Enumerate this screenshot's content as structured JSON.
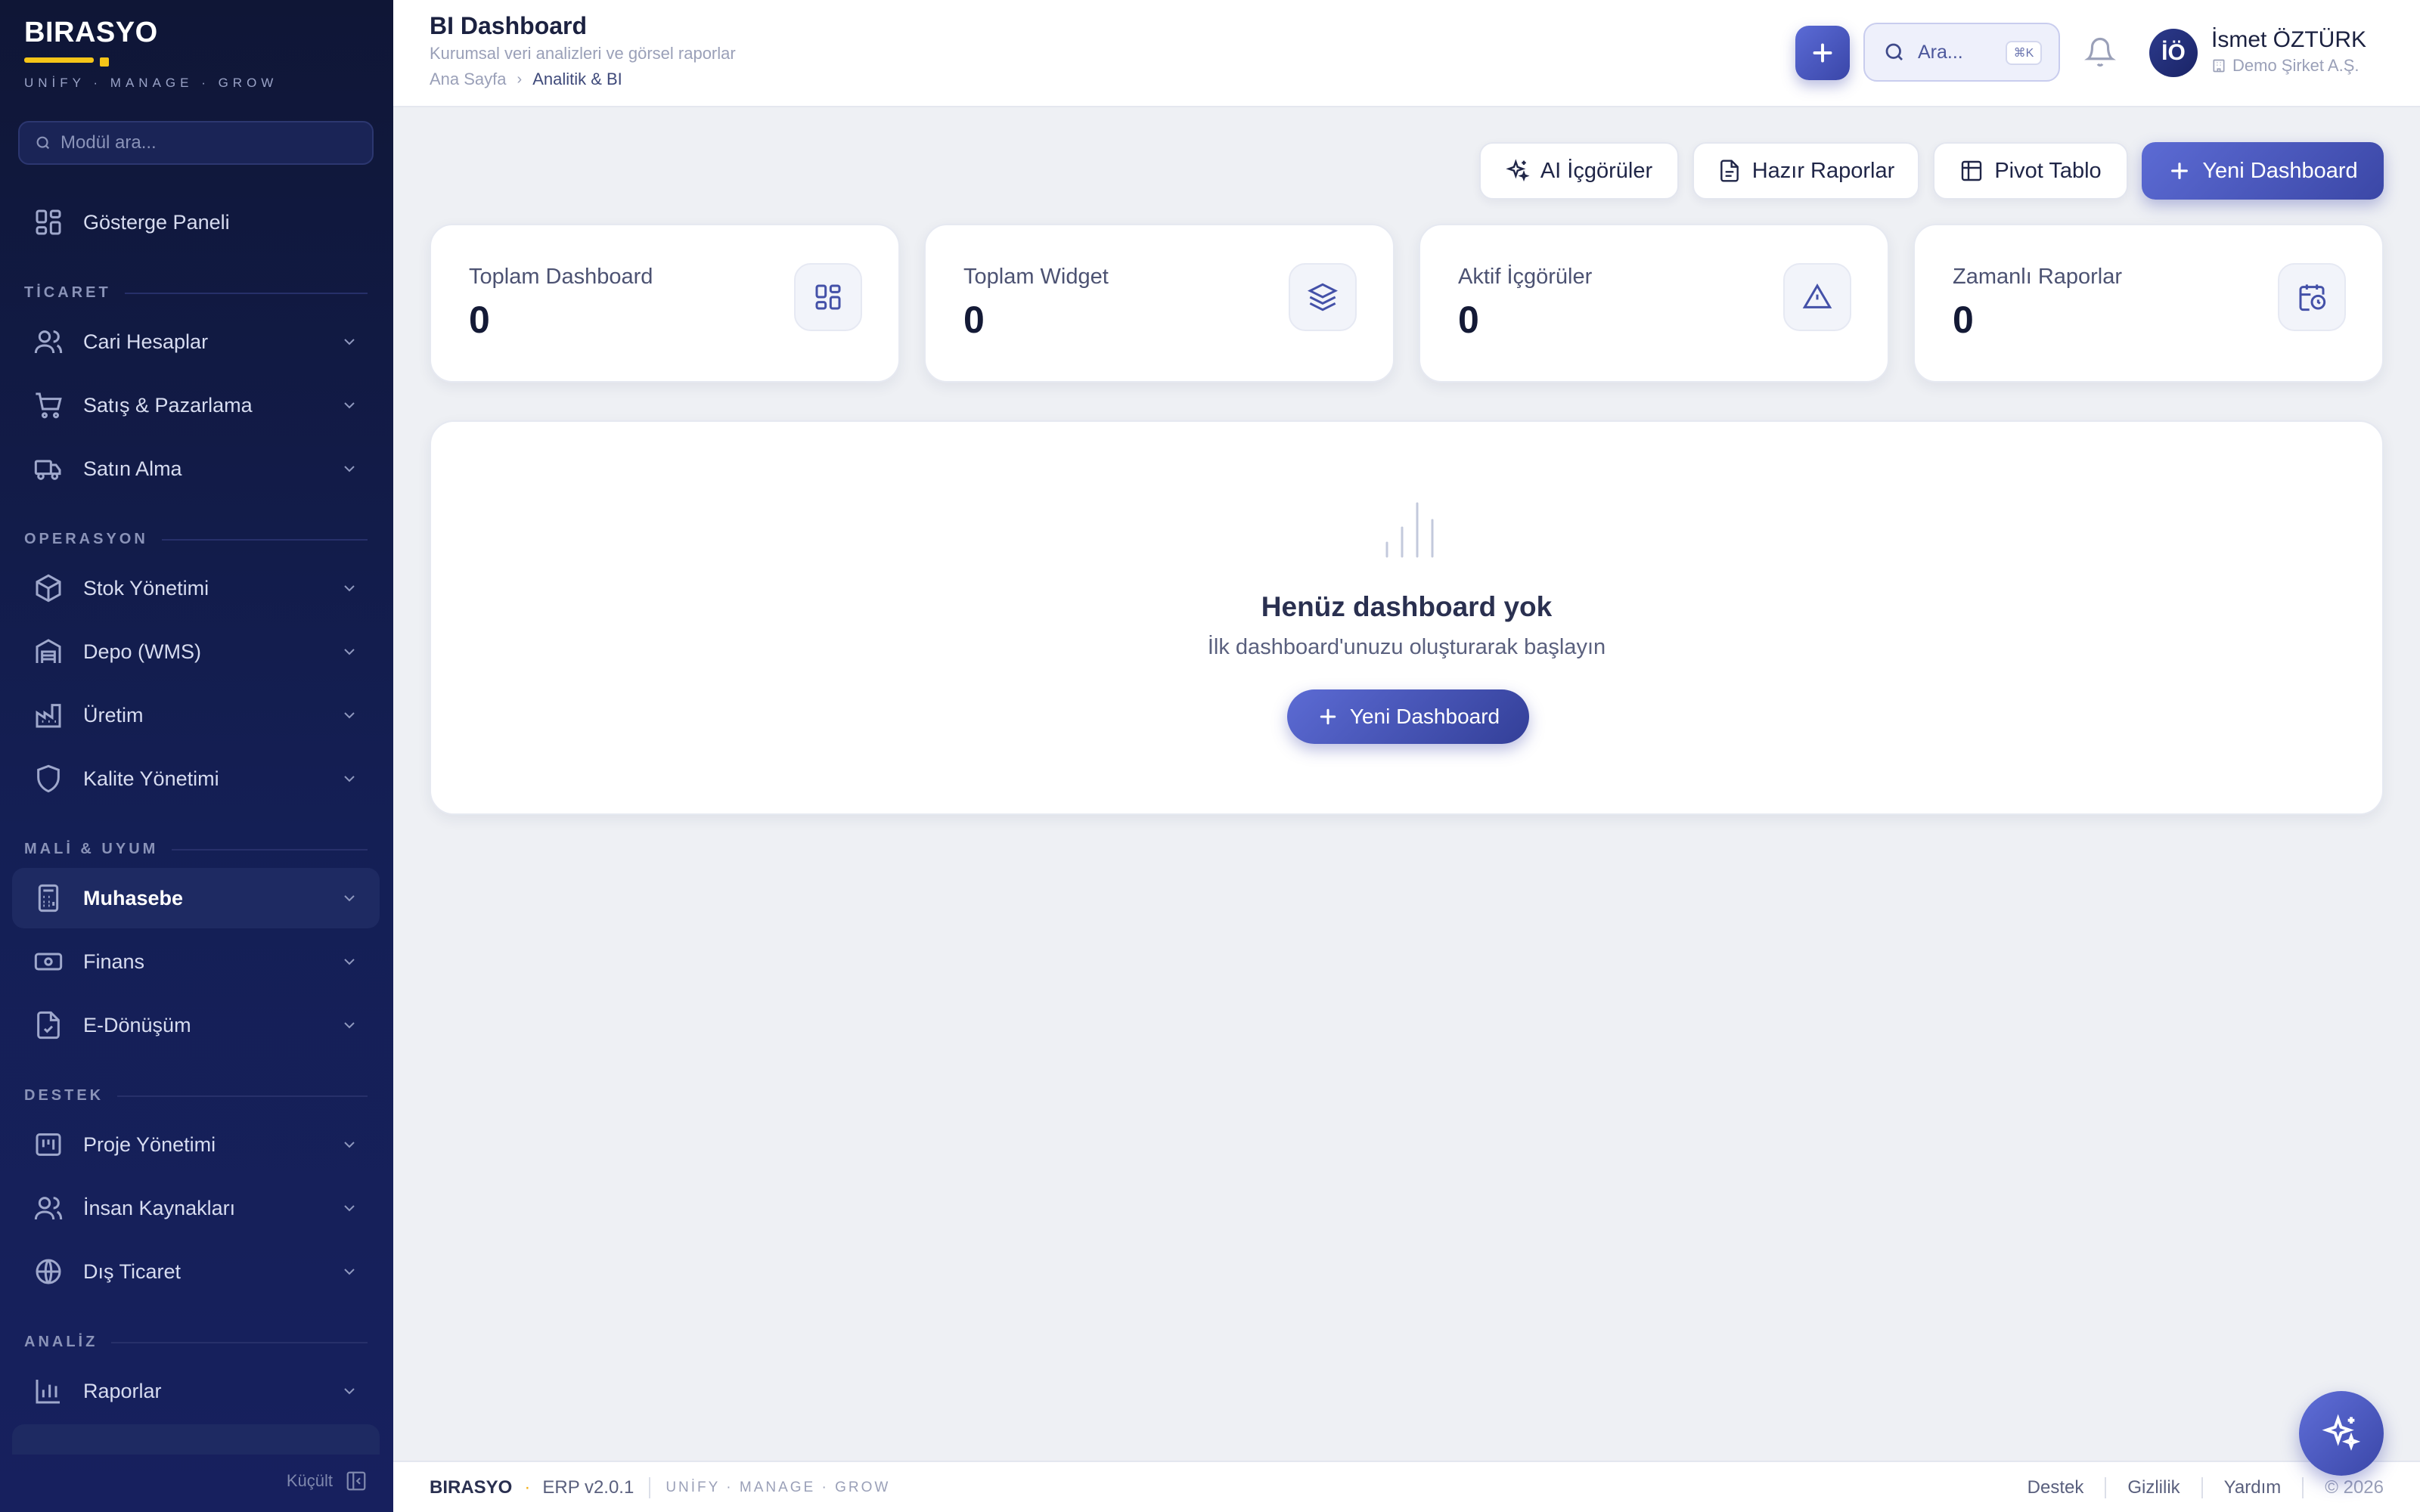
{
  "brand": {
    "name": "BIRASYO",
    "tagline": "UNİFY · MANAGE · GROW"
  },
  "sidebar": {
    "search_placeholder": "Modül ara...",
    "dashboard_label": "Gösterge Paneli",
    "sections": {
      "ticaret": "TİCARET",
      "operasyon": "OPERASYON",
      "mali": "MALİ & UYUM",
      "destek": "DESTEK",
      "analiz": "ANALİZ"
    },
    "items": {
      "cari": "Cari Hesaplar",
      "satis": "Satış & Pazarlama",
      "satinalma": "Satın Alma",
      "stok": "Stok Yönetimi",
      "depo": "Depo (WMS)",
      "uretim": "Üretim",
      "kalite": "Kalite Yönetimi",
      "muhasebe": "Muhasebe",
      "finans": "Finans",
      "edonusum": "E-Dönüşüm",
      "proje": "Proje Yönetimi",
      "ik": "İnsan Kaynakları",
      "dis": "Dış Ticaret",
      "raporlar": "Raporlar"
    },
    "active_item": "Muhasebe",
    "collapse_label": "Küçült"
  },
  "header": {
    "title": "BI Dashboard",
    "subtitle": "Kurumsal veri analizleri ve görsel raporlar",
    "breadcrumb": [
      "Ana Sayfa",
      "Analitik & BI"
    ],
    "search_label": "Ara...",
    "search_shortcut": "⌘K",
    "user": {
      "initials": "İÖ",
      "name": "İsmet ÖZTÜRK",
      "company": "Demo Şirket A.Ş."
    }
  },
  "actions": {
    "ai": "AI İçgörüler",
    "reports": "Hazır Raporlar",
    "pivot": "Pivot Tablo",
    "new": "Yeni Dashboard"
  },
  "stats": [
    {
      "label": "Toplam Dashboard",
      "value": "0",
      "icon": "grid-icon"
    },
    {
      "label": "Toplam Widget",
      "value": "0",
      "icon": "layers-icon"
    },
    {
      "label": "Aktif İçgörüler",
      "value": "0",
      "icon": "alert-triangle-icon"
    },
    {
      "label": "Zamanlı Raporlar",
      "value": "0",
      "icon": "calendar-clock-icon"
    }
  ],
  "empty_state": {
    "title": "Henüz dashboard yok",
    "subtitle": "İlk dashboard'unuzu oluşturarak başlayın",
    "button": "Yeni Dashboard"
  },
  "footer": {
    "brand": "BIRASYO",
    "version": "ERP v2.0.1",
    "tagline": "UNİFY · MANAGE · GROW",
    "links": [
      "Destek",
      "Gizlilik",
      "Yardım"
    ],
    "copyright": "© 2026"
  },
  "colors": {
    "sidebar_bg": "#141f55",
    "accent": "#4a58c0",
    "brand_yellow": "#f5c518",
    "page_bg": "#eef0f4"
  }
}
